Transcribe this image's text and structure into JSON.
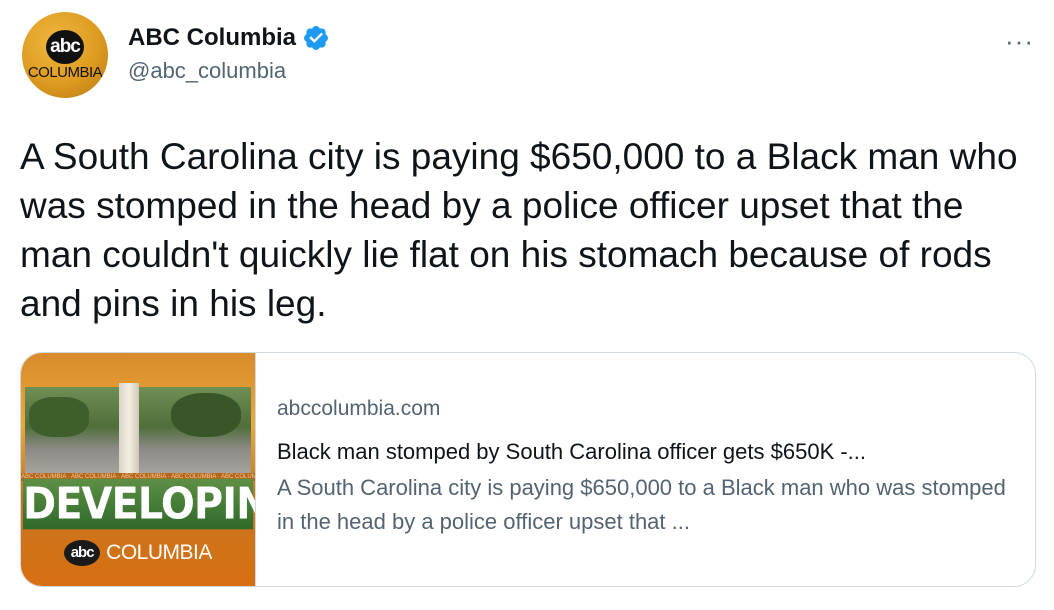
{
  "author": {
    "display_name": "ABC Columbia",
    "handle": "@abc_columbia",
    "verified": true,
    "avatar_icon": "abc-columbia-logo",
    "avatar_logo_text": "abc",
    "avatar_sub_text": "COLUMBIA"
  },
  "tweet": {
    "text": "A South Carolina city is paying $650,000 to a Black man who was stomped in the head by a police officer upset that the man couldn't quickly lie flat on his stomach because of rods and pins in his leg."
  },
  "more_menu": {
    "icon": "more-icon",
    "glyph": "···"
  },
  "link_card": {
    "domain": "abccolumbia.com",
    "title": "Black man stomped by South Carolina officer gets $650K -...",
    "description": "A South Carolina city is paying $650,000 to a Black man who was stomped in the head by a police officer upset that ...",
    "thumbnail": {
      "headline": "DEVELOPING",
      "brand_logo": "abc",
      "brand_text": "COLUMBIA",
      "ticker": "ABC COLUMBIA · ABC COLUMBIA · ABC COLUMBIA · ABC COLUMBIA · ABC COLUMBIA"
    }
  },
  "colors": {
    "text": "#0f1419",
    "secondary": "#536471",
    "verified": "#1d9bf0",
    "border": "#cfd9de"
  }
}
